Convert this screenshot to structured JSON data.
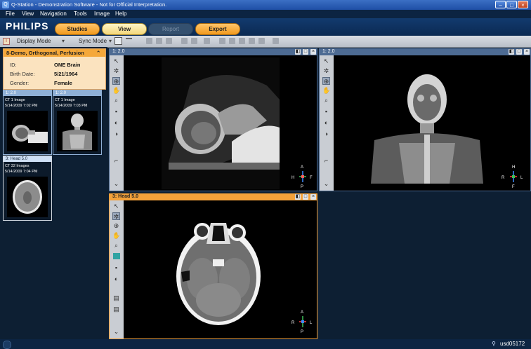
{
  "window": {
    "title": "Q-Station - Demonstration Software - Not for Official Interpretation.",
    "app_icon": "Q"
  },
  "menu": [
    "File",
    "View",
    "Navigation",
    "Tools",
    "Image",
    "Help"
  ],
  "brand": {
    "logo": "PHILIPS"
  },
  "nav_tabs": [
    {
      "label": "Studies",
      "state": "enabled"
    },
    {
      "label": "View",
      "state": "active"
    },
    {
      "label": "Report",
      "state": "disabled"
    },
    {
      "label": "Export",
      "state": "enabled"
    }
  ],
  "toolbar": {
    "display_mode_label": "Display Mode",
    "sync_mode_label": "Sync Mode"
  },
  "patient": {
    "study": "8-Demo, Orthogonal, Perfusion",
    "fields": [
      {
        "label": "ID:",
        "value": "ONE Brain"
      },
      {
        "label": "Birth Date:",
        "value": "5/21/1964"
      },
      {
        "label": "Gender:",
        "value": "Female"
      }
    ]
  },
  "series": [
    {
      "id": "1: 2.0",
      "desc": "CT 1 Image",
      "date": "5/14/2009 7:02 PM",
      "thumb": "lateral-scout"
    },
    {
      "id": "1: 2.0",
      "desc": "CT 1 Image",
      "date": "5/14/2009 7:03 PM",
      "thumb": "frontal-scout"
    },
    {
      "id": "3: Head 5.0",
      "desc": "CT 32 Images",
      "date": "5/14/2009 7:04 PM",
      "thumb": "axial-head"
    }
  ],
  "viewports": [
    {
      "title": "1: 2.0",
      "orientation": [
        "A",
        "H",
        "F",
        "P"
      ]
    },
    {
      "title": "1: 2.0",
      "orientation": [
        "H",
        "R",
        "L",
        "F"
      ]
    },
    {
      "title": "3: Head 5.0",
      "orientation": [
        "A",
        "R",
        "L",
        "P"
      ]
    }
  ],
  "status": {
    "user": "usd05172"
  },
  "colors": {
    "accent_orange": "#f3a13a",
    "background": "#0d1f33",
    "viewport_border_blue": "#4d6b93"
  }
}
